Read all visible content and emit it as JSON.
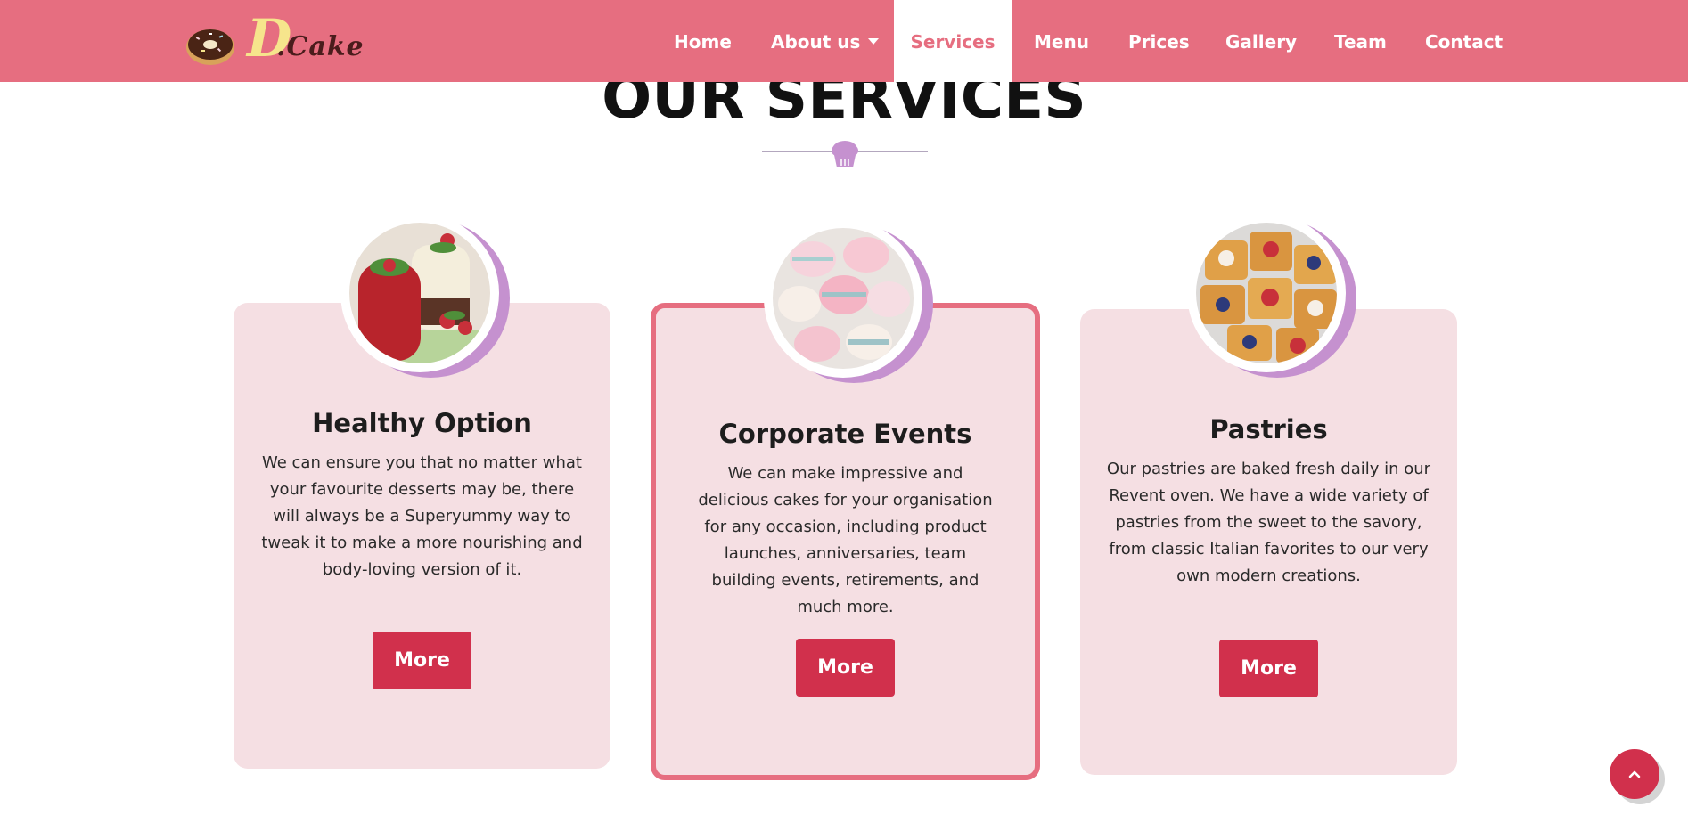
{
  "brand": {
    "logo_letter": "D",
    "logo_text": ".Cake"
  },
  "nav": {
    "items": [
      {
        "label": "Home"
      },
      {
        "label": "About us"
      },
      {
        "label": "Services"
      },
      {
        "label": "Menu"
      },
      {
        "label": "Prices"
      },
      {
        "label": "Gallery"
      },
      {
        "label": "Team"
      },
      {
        "label": "Contact"
      }
    ],
    "active": "Services",
    "dropdown_item": "About us"
  },
  "section": {
    "title": "OUR SERVICES",
    "divider_icon": "cupcake-icon"
  },
  "cards": [
    {
      "title": "Healthy Option",
      "text": "We can ensure you that no matter what your favourite desserts may be, there will always be a Superyummy way to tweak it to make a more nourishing and body-loving version of it.",
      "button": "More",
      "image": "strawberry-mousse-cakes-image",
      "featured": false
    },
    {
      "title": "Corporate Events",
      "text": "We can make impressive and delicious cakes for your organisation for any occasion, including product launches, anniversaries, team building events, retirements, and much more.",
      "button": "More",
      "image": "macarons-image",
      "featured": true
    },
    {
      "title": "Pastries",
      "text": "Our pastries are baked fresh daily in our Revent oven. We have a wide variety of pastries from the sweet to the savory, from classic Italian favorites to our very own modern creations.",
      "button": "More",
      "image": "berry-pastries-image",
      "featured": false
    }
  ],
  "scroll_top": {
    "icon": "chevron-up-icon"
  },
  "colors": {
    "navbar": "#e66e80",
    "card_bg": "#f5dfe3",
    "button": "#d1304c",
    "accent_purple": "#c591cf",
    "logo_yellow": "#f6e58c"
  }
}
